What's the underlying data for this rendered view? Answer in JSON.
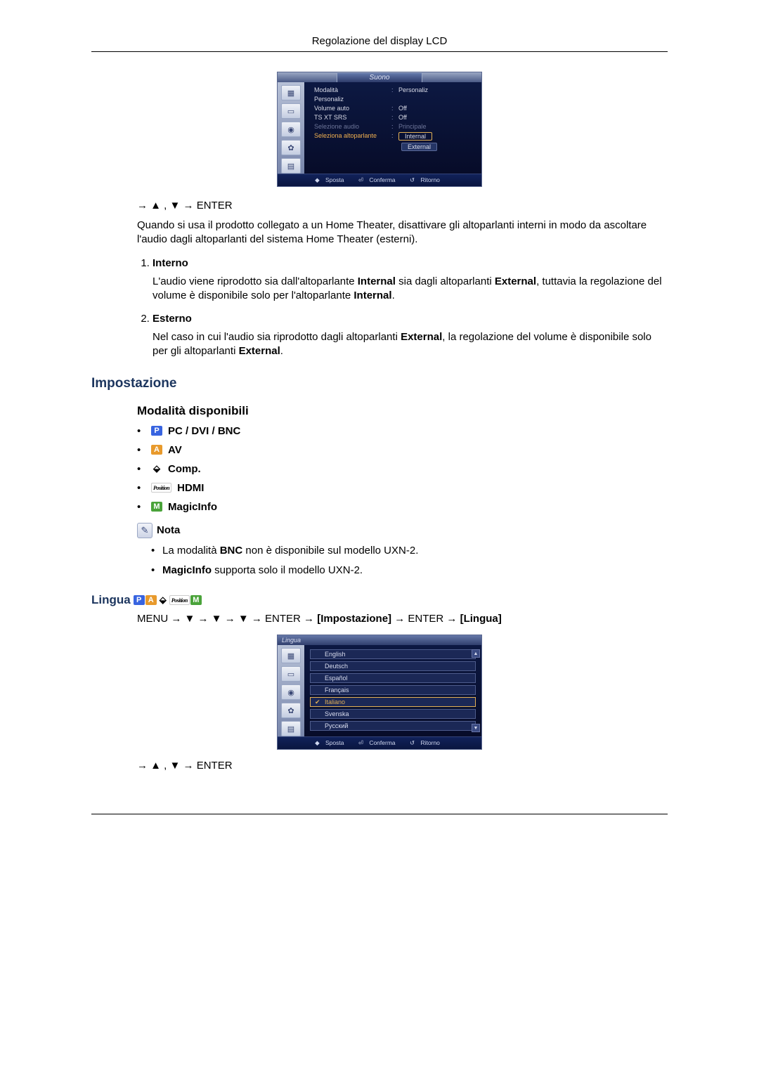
{
  "header_title": "Regolazione del display LCD",
  "osd1": {
    "title": "Suono",
    "rows": [
      {
        "label": "Modalità",
        "value": "Personaliz"
      },
      {
        "label": "Personaliz",
        "value": ""
      },
      {
        "label": "Volume auto",
        "value": "Off"
      },
      {
        "label": "TS XT SRS",
        "value": "Off"
      },
      {
        "label": "Selezione audio",
        "value": "Principale",
        "dim": true
      },
      {
        "label": "Seleziona altoparlante",
        "value": "Internal",
        "hl": true,
        "selected": true
      }
    ],
    "extra_btn": "External",
    "footer": {
      "move": "Sposta",
      "confirm": "Conferma",
      "return": "Ritorno"
    }
  },
  "enter_line1": "→ ▲ , ▼ → ENTER",
  "intro_para_parts": [
    "Quando si usa il prodotto collegato a un Home Theater, disattivare gli altoparlanti interni in modo da ascoltare l'audio dagli altoparlanti del sistema Home Theater (esterni)."
  ],
  "list_items": [
    {
      "title": "Interno",
      "body_parts": [
        "L'audio viene riprodotto sia dall'altoparlante ",
        {
          "b": "Internal"
        },
        " sia dagli altoparlanti ",
        {
          "b": "External"
        },
        ", tuttavia la regolazione del volume è disponibile solo per l'altoparlante ",
        {
          "b": "Internal"
        },
        "."
      ]
    },
    {
      "title": "Esterno",
      "body_parts": [
        "Nel caso in cui l'audio sia riprodotto dagli altoparlanti ",
        {
          "b": "External"
        },
        ", la regolazione del volume è disponibile solo per gli altoparlanti ",
        {
          "b": "External"
        },
        "."
      ]
    }
  ],
  "impostazione_h": "Impostazione",
  "modalita_h": "Modalità disponibili",
  "modes": [
    {
      "badge": "P",
      "cls": "badge-p",
      "label": "PC / DVI / BNC"
    },
    {
      "badge": "A",
      "cls": "badge-a",
      "label": "AV"
    },
    {
      "badge": "⬙",
      "cls": "badge-comp",
      "label": "Comp."
    },
    {
      "badge": "Position",
      "cls": "badge-hdmi",
      "label": "HDMI"
    },
    {
      "badge": "M",
      "cls": "badge-m",
      "label": "MagicInfo"
    }
  ],
  "nota_label": "Nota",
  "nota_items": [
    {
      "parts": [
        "La modalità ",
        {
          "b": "BNC"
        },
        " non è disponibile sul modello UXN-2."
      ]
    },
    {
      "parts": [
        {
          "b": "MagicInfo"
        },
        " supporta solo il modello UXN-2."
      ]
    }
  ],
  "lingua_h": "Lingua",
  "menu_path_parts": [
    "MENU → ▼ → ▼ → ▼ → ENTER → ",
    {
      "b": "[Impostazione]"
    },
    " → ENTER → ",
    {
      "b": "[Lingua]"
    }
  ],
  "osd2": {
    "title": "Lingua",
    "items": [
      {
        "label": "English"
      },
      {
        "label": "Deutsch"
      },
      {
        "label": "Español"
      },
      {
        "label": "Français"
      },
      {
        "label": "Italiano",
        "selected": true
      },
      {
        "label": "Svenska"
      },
      {
        "label": "Русский"
      }
    ],
    "footer": {
      "move": "Sposta",
      "confirm": "Conferma",
      "return": "Ritorno"
    }
  },
  "enter_line2": "→ ▲ , ▼ → ENTER"
}
